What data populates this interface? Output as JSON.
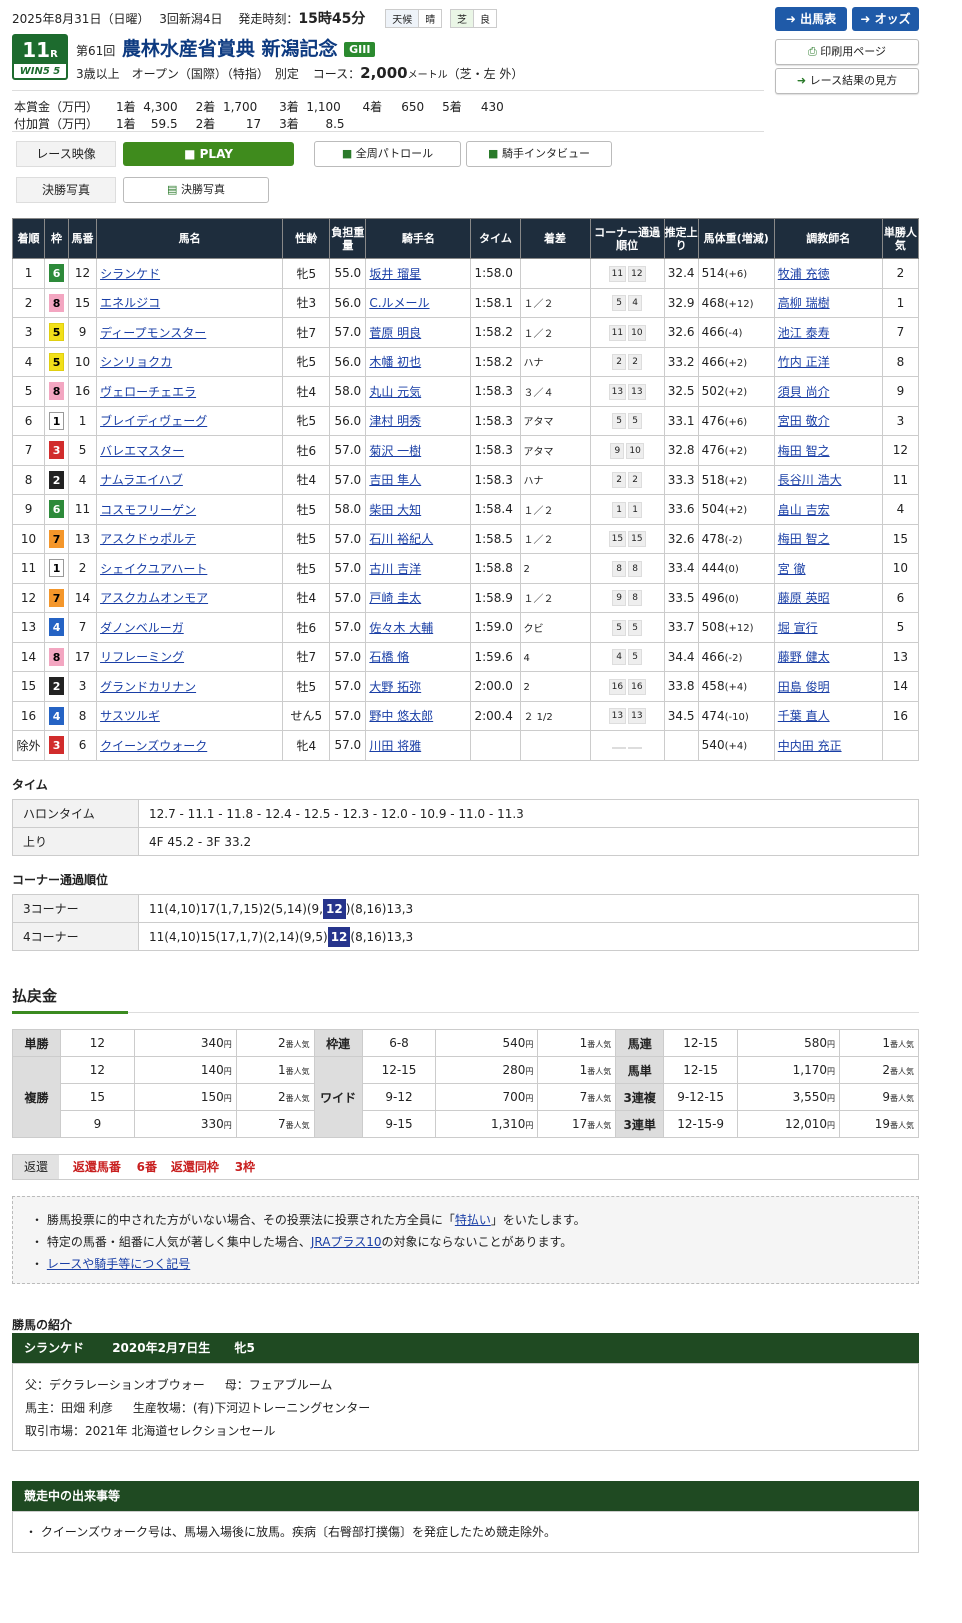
{
  "header": {
    "date": "2025年8月31日（日曜）",
    "kaisai": "3回新潟4日",
    "post_label": "発走時刻：",
    "post_time": "15時45分",
    "weather_label": "天候",
    "weather": "晴",
    "track_label": "芝",
    "track_cond": "良"
  },
  "race": {
    "num": "11",
    "num_suffix": "R",
    "win5": "WIN5 5",
    "kai": "第61回",
    "name": "農林水産省賞典 新潟記念",
    "grade": "GIII",
    "cond1": "3歳以上　オープン（国際）（特指）　別定",
    "course_label": "コース：",
    "distance": "2,000",
    "dist_unit": "メートル",
    "surface": "（芝・左 外）"
  },
  "buttons": {
    "entries": "出馬表",
    "odds": "オッズ",
    "print": "印刷用ページ",
    "howto": "レース結果の見方"
  },
  "prize": {
    "main_label": "本賞金（万円）",
    "main": [
      [
        "1着",
        "4,300"
      ],
      [
        "2着",
        "1,700"
      ],
      [
        "3着",
        "1,100"
      ],
      [
        "4着",
        "650"
      ],
      [
        "5着",
        "430"
      ]
    ],
    "add_label": "付加賞（万円）",
    "add": [
      [
        "1着",
        "59.5"
      ],
      [
        "2着",
        "17"
      ],
      [
        "3着",
        "8.5"
      ]
    ]
  },
  "media": {
    "video_label": "レース映像",
    "play": "PLAY",
    "patrol": "全周パトロール",
    "interview": "騎手インタビュー",
    "photo_label": "決勝写真",
    "photo_btn": "決勝写真"
  },
  "table": {
    "headers": [
      "着順",
      "枠",
      "馬番",
      "馬名",
      "性齢",
      "負担重量",
      "騎手名",
      "タイム",
      "着差",
      "コーナー通過順位",
      "推定上り",
      "馬体重(増減)",
      "調教師名",
      "単勝人気"
    ],
    "rows": [
      {
        "rank": "1",
        "waku": "6",
        "num": "12",
        "horse": "シランケド",
        "sex": "牝5",
        "wt": "55.0",
        "jockey": "坂井 瑠星",
        "time": "1:58.0",
        "margin": "",
        "c1": "11",
        "c2": "12",
        "f3": "32.4",
        "bw": "514",
        "bwd": "(+6)",
        "trainer": "牧浦 充徳",
        "pop": "2"
      },
      {
        "rank": "2",
        "waku": "8",
        "num": "15",
        "horse": "エネルジコ",
        "sex": "牡3",
        "wt": "56.0",
        "jockey": "C.ルメール",
        "time": "1:58.1",
        "margin": "１／２",
        "c1": "5",
        "c2": "4",
        "f3": "32.9",
        "bw": "468",
        "bwd": "(+12)",
        "trainer": "高柳 瑞樹",
        "pop": "1"
      },
      {
        "rank": "3",
        "waku": "5",
        "num": "9",
        "horse": "ディープモンスター",
        "sex": "牡7",
        "wt": "57.0",
        "jockey": "菅原 明良",
        "time": "1:58.2",
        "margin": "１／２",
        "c1": "11",
        "c2": "10",
        "f3": "32.6",
        "bw": "466",
        "bwd": "(-4)",
        "trainer": "池江 泰寿",
        "pop": "7"
      },
      {
        "rank": "4",
        "waku": "5",
        "num": "10",
        "horse": "シンリョクカ",
        "sex": "牝5",
        "wt": "56.0",
        "jockey": "木幡 初也",
        "time": "1:58.2",
        "margin": "ハナ",
        "c1": "2",
        "c2": "2",
        "f3": "33.2",
        "bw": "466",
        "bwd": "(+2)",
        "trainer": "竹内 正洋",
        "pop": "8"
      },
      {
        "rank": "5",
        "waku": "8",
        "num": "16",
        "horse": "ヴェローチェエラ",
        "sex": "牡4",
        "wt": "58.0",
        "jockey": "丸山 元気",
        "time": "1:58.3",
        "margin": "３／４",
        "c1": "13",
        "c2": "13",
        "f3": "32.5",
        "bw": "502",
        "bwd": "(+2)",
        "trainer": "須貝 尚介",
        "pop": "9"
      },
      {
        "rank": "6",
        "waku": "1",
        "num": "1",
        "horse": "ブレイディヴェーグ",
        "sex": "牝5",
        "wt": "56.0",
        "jockey": "津村 明秀",
        "time": "1:58.3",
        "margin": "アタマ",
        "c1": "5",
        "c2": "5",
        "f3": "33.1",
        "bw": "476",
        "bwd": "(+6)",
        "trainer": "宮田 敬介",
        "pop": "3"
      },
      {
        "rank": "7",
        "waku": "3",
        "num": "5",
        "horse": "バレエマスター",
        "sex": "牡6",
        "wt": "57.0",
        "jockey": "菊沢 一樹",
        "time": "1:58.3",
        "margin": "アタマ",
        "c1": "9",
        "c2": "10",
        "f3": "32.8",
        "bw": "476",
        "bwd": "(+2)",
        "trainer": "梅田 智之",
        "pop": "12"
      },
      {
        "rank": "8",
        "waku": "2",
        "num": "4",
        "horse": "ナムラエイハブ",
        "sex": "牡4",
        "wt": "57.0",
        "jockey": "吉田 隼人",
        "time": "1:58.3",
        "margin": "ハナ",
        "c1": "2",
        "c2": "2",
        "f3": "33.3",
        "bw": "518",
        "bwd": "(+2)",
        "trainer": "長谷川 浩大",
        "pop": "11"
      },
      {
        "rank": "9",
        "waku": "6",
        "num": "11",
        "horse": "コスモフリーゲン",
        "sex": "牡5",
        "wt": "58.0",
        "jockey": "柴田 大知",
        "time": "1:58.4",
        "margin": "１／２",
        "c1": "1",
        "c2": "1",
        "f3": "33.6",
        "bw": "504",
        "bwd": "(+2)",
        "trainer": "畠山 吉宏",
        "pop": "4"
      },
      {
        "rank": "10",
        "waku": "7",
        "num": "13",
        "horse": "アスクドゥポルテ",
        "sex": "牡5",
        "wt": "57.0",
        "jockey": "石川 裕紀人",
        "time": "1:58.5",
        "margin": "１／２",
        "c1": "15",
        "c2": "15",
        "f3": "32.6",
        "bw": "478",
        "bwd": "(-2)",
        "trainer": "梅田 智之",
        "pop": "15"
      },
      {
        "rank": "11",
        "waku": "1",
        "num": "2",
        "horse": "シェイクユアハート",
        "sex": "牡5",
        "wt": "57.0",
        "jockey": "古川 吉洋",
        "time": "1:58.8",
        "margin": "2",
        "c1": "8",
        "c2": "8",
        "f3": "33.4",
        "bw": "444",
        "bwd": "(0)",
        "trainer": "宮 徹",
        "pop": "10"
      },
      {
        "rank": "12",
        "waku": "7",
        "num": "14",
        "horse": "アスクカムオンモア",
        "sex": "牡4",
        "wt": "57.0",
        "jockey": "戸崎 圭太",
        "time": "1:58.9",
        "margin": "１／２",
        "c1": "9",
        "c2": "8",
        "f3": "33.5",
        "bw": "496",
        "bwd": "(0)",
        "trainer": "藤原 英昭",
        "pop": "6"
      },
      {
        "rank": "13",
        "waku": "4",
        "num": "7",
        "horse": "ダノンベルーガ",
        "sex": "牡6",
        "wt": "57.0",
        "jockey": "佐々木 大輔",
        "time": "1:59.0",
        "margin": "クビ",
        "c1": "5",
        "c2": "5",
        "f3": "33.7",
        "bw": "508",
        "bwd": "(+12)",
        "trainer": "堀 宣行",
        "pop": "5"
      },
      {
        "rank": "14",
        "waku": "8",
        "num": "17",
        "horse": "リフレーミング",
        "sex": "牡7",
        "wt": "57.0",
        "jockey": "石橋 脩",
        "time": "1:59.6",
        "margin": "4",
        "c1": "4",
        "c2": "5",
        "f3": "34.4",
        "bw": "466",
        "bwd": "(-2)",
        "trainer": "藤野 健太",
        "pop": "13"
      },
      {
        "rank": "15",
        "waku": "2",
        "num": "3",
        "horse": "グランドカリナン",
        "sex": "牡5",
        "wt": "57.0",
        "jockey": "大野 拓弥",
        "time": "2:00.0",
        "margin": "2",
        "c1": "16",
        "c2": "16",
        "f3": "33.8",
        "bw": "458",
        "bwd": "(+4)",
        "trainer": "田島 俊明",
        "pop": "14"
      },
      {
        "rank": "16",
        "waku": "4",
        "num": "8",
        "horse": "サスツルギ",
        "sex": "せん5",
        "wt": "57.0",
        "jockey": "野中 悠太郎",
        "time": "2:00.4",
        "margin": "２ 1/2",
        "c1": "13",
        "c2": "13",
        "f3": "34.5",
        "bw": "474",
        "bwd": "(-10)",
        "trainer": "千葉 直人",
        "pop": "16"
      },
      {
        "rank": "除外",
        "waku": "3",
        "num": "6",
        "horse": "クイーンズウォーク",
        "sex": "牝4",
        "wt": "57.0",
        "jockey": "川田 将雅",
        "time": "",
        "margin": "",
        "c1": "",
        "c2": "",
        "f3": "",
        "bw": "540",
        "bwd": "(+4)",
        "trainer": "中内田 充正",
        "pop": ""
      }
    ]
  },
  "time": {
    "title": "タイム",
    "halon_label": "ハロンタイム",
    "halon": "12.7 - 11.1 - 11.8 - 12.4 - 12.5 - 12.3 - 12.0 - 10.9 - 11.0 - 11.3",
    "agari_label": "上り",
    "agari": "4F 45.2 - 3F 33.2"
  },
  "corner": {
    "title": "コーナー通過順位",
    "c3_label": "3コーナー",
    "c3_pre": "11(4,10)17(1,7,15)2(5,14)(9,",
    "c3_hl": "12",
    "c3_post": ")(8,16)13,3",
    "c4_label": "4コーナー",
    "c4_pre": "11(4,10)15(17,1,7)(2,14)(9,5)",
    "c4_hl": "12",
    "c4_post": "(8,16)13,3"
  },
  "payout": {
    "title": "払戻金",
    "yen": "円",
    "ninki": "番人気",
    "tansho": {
      "label": "単勝",
      "rows": [
        [
          "12",
          "340",
          "2"
        ]
      ]
    },
    "fukusho": {
      "label": "複勝",
      "rows": [
        [
          "12",
          "140",
          "1"
        ],
        [
          "15",
          "150",
          "2"
        ],
        [
          "9",
          "330",
          "7"
        ]
      ]
    },
    "wakuren": {
      "label": "枠連",
      "rows": [
        [
          "6-8",
          "540",
          "1"
        ]
      ]
    },
    "wide": {
      "label": "ワイド",
      "rows": [
        [
          "12-15",
          "280",
          "1"
        ],
        [
          "9-12",
          "700",
          "7"
        ],
        [
          "9-15",
          "1,310",
          "17"
        ]
      ]
    },
    "umaren": {
      "label": "馬連",
      "rows": [
        [
          "12-15",
          "580",
          "1"
        ]
      ]
    },
    "umatan": {
      "label": "馬単",
      "rows": [
        [
          "12-15",
          "1,170",
          "2"
        ]
      ]
    },
    "sanrenpuku": {
      "label": "3連複",
      "rows": [
        [
          "9-12-15",
          "3,550",
          "9"
        ]
      ]
    },
    "sanrentan": {
      "label": "3連単",
      "rows": [
        [
          "12-15-9",
          "12,010",
          "19"
        ]
      ]
    }
  },
  "henkan": {
    "label": "返還",
    "uma_label": "返還馬番",
    "uma": "6番",
    "waku_label": "返還同枠",
    "waku": "3枠"
  },
  "notes": {
    "n1_pre": "・ 勝馬投票に的中された方がいない場合、その投票法に投票された方全員に「",
    "n1_link": "特払い",
    "n1_post": "」をいたします。",
    "n2_pre": "・ 特定の馬番・組番に人気が著しく集中した場合、",
    "n2_link": "JRAプラス10",
    "n2_post": "の対象にならないことがあります。",
    "n3_pre": "・ ",
    "n3_link": "レースや騎手等につく記号"
  },
  "winner": {
    "title": "勝馬の紹介",
    "name": "シランケド",
    "birth": "2020年2月7日生",
    "sex": "牝5",
    "sire": "父：デクラレーションオブウォー",
    "dam": "母：フェアブルーム",
    "owner": "馬主：田畑 利彦",
    "breeder": "生産牧場：(有)下河辺トレーニングセンター",
    "market": "取引市場：2021年 北海道セレクションセール"
  },
  "incident": {
    "title": "競走中の出来事等",
    "text": "・ クイーンズウォーク号は、馬場入場後に放馬。疾病〔右臀部打撲傷〕を発症したため競走除外。"
  }
}
